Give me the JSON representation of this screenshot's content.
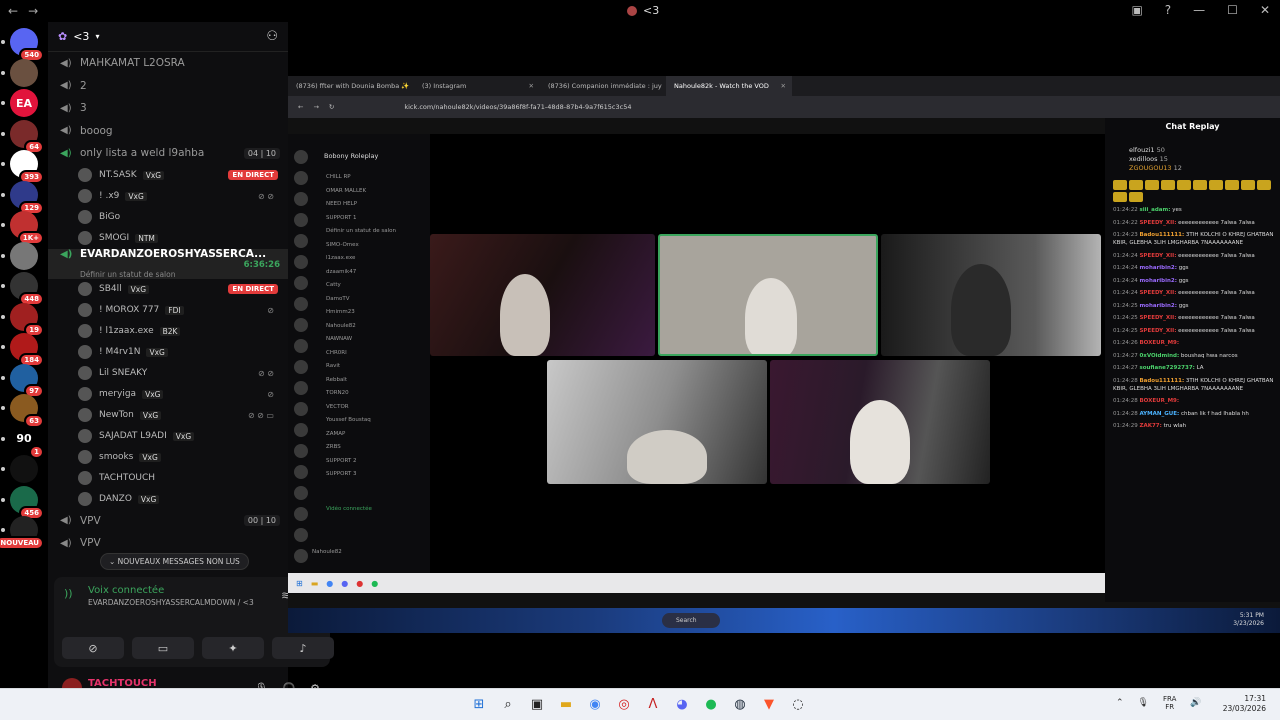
{
  "window": {
    "title": "<3"
  },
  "servers": [
    {
      "label": "",
      "badge": "540",
      "color": "#5865f2"
    },
    {
      "label": "",
      "badge": "",
      "color": "#6a5040"
    },
    {
      "label": "EA",
      "badge": "",
      "color": "#e1143c"
    },
    {
      "label": "",
      "badge": "64",
      "color": "#7a2a2a"
    },
    {
      "label": "",
      "badge": "393",
      "color": "#ffffff"
    },
    {
      "label": "",
      "badge": "129",
      "color": "#2f3a8a"
    },
    {
      "label": "",
      "badge": "1K+",
      "color": "#c03030"
    },
    {
      "label": "",
      "badge": "",
      "color": "#777"
    },
    {
      "label": "",
      "badge": "448",
      "color": "#333"
    },
    {
      "label": "",
      "badge": "19",
      "color": "#a02020"
    },
    {
      "label": "",
      "badge": "184",
      "color": "#b01a1a"
    },
    {
      "label": "",
      "badge": "97",
      "color": "#2060a0"
    },
    {
      "label": "",
      "badge": "63",
      "color": "#8a5a20"
    },
    {
      "label": "90",
      "badge": "1",
      "color": "#000"
    },
    {
      "label": "",
      "badge": "",
      "color": "#111"
    },
    {
      "label": "",
      "badge": "456",
      "color": "#1a6a4a"
    },
    {
      "label": "",
      "badge": "NOUVEAU",
      "color": "#222"
    }
  ],
  "server_header": {
    "name": "<3"
  },
  "channels": [
    {
      "type": "vc",
      "name": "MAHKAMAT L2OSRA"
    },
    {
      "type": "vc",
      "name": "2"
    },
    {
      "type": "vc",
      "name": "3"
    },
    {
      "type": "vc",
      "name": "booog"
    },
    {
      "type": "vc",
      "name": "only lista a weld l9ahba",
      "count": "04 | 10",
      "green": true
    },
    {
      "type": "member",
      "name": "NT.SASK",
      "tag": "VxG",
      "live": "EN DIRECT"
    },
    {
      "type": "member",
      "name": "! .x9",
      "tag": "VxG",
      "mute": "⊘ ⊘"
    },
    {
      "type": "member",
      "name": "BiGo"
    },
    {
      "type": "member",
      "name": "SMOGI",
      "tag": "NTM"
    },
    {
      "type": "active",
      "name": "EVARDANZOEROSHYASSERCA...",
      "timer": "6:36:26",
      "status": "Définir un statut de salon"
    },
    {
      "type": "member",
      "name": "SB4ll",
      "tag": "VxG",
      "live": "EN DIRECT"
    },
    {
      "type": "member",
      "name": "! MOROX 777",
      "tag": "FDI",
      "mute": "⊘"
    },
    {
      "type": "member",
      "name": "! l1zaax.exe",
      "tag": "B2K"
    },
    {
      "type": "member",
      "name": "! M4rv1N",
      "tag": "VxG"
    },
    {
      "type": "member",
      "name": "Lil SNEAKY",
      "mute": "⊘ ⊘"
    },
    {
      "type": "member",
      "name": "meryiga",
      "tag": "VxG",
      "mute": "⊘"
    },
    {
      "type": "member",
      "name": "NewTon",
      "tag": "VxG",
      "mute": "⊘ ⊘ ▭"
    },
    {
      "type": "member",
      "name": "SAJADAT L9ADI",
      "tag": "VxG"
    },
    {
      "type": "member",
      "name": "smooks",
      "tag": "VxG"
    },
    {
      "type": "member",
      "name": "TACHTOUCH"
    },
    {
      "type": "member",
      "name": "DANZO",
      "tag": "VxG"
    },
    {
      "type": "vc",
      "name": "VPV",
      "count": "00 | 10"
    },
    {
      "type": "vc",
      "name": "VPV"
    }
  ],
  "unread_pill": "NOUVEAUX MESSAGES NON LUS",
  "voice": {
    "title": "Voix connectée",
    "channel": "EVARDANZOEROSHYASSERCALMDOWN / <3"
  },
  "user": {
    "name": "TACHTOUCH",
    "id": "tachtouch"
  },
  "browser": {
    "tabs": [
      {
        "label": "(8736) ffter with Dounia Bomba ✨"
      },
      {
        "label": "(3) Instagram"
      },
      {
        "label": "(8736) Companion immédiate : juy"
      },
      {
        "label": "Nahoule82k - Watch the VOD",
        "selected": true
      }
    ],
    "url": "kick.com/nahoule82k/videos/39a86f8f-fa71-48d8-87b4-9a7f615c3c54"
  },
  "inner_discord": {
    "server": "Bobony Roleplay",
    "rows": [
      "CHILL RP",
      "OMAR MALLEK",
      "NEED HELP",
      "SUPPORT 1",
      "Définir un statut de salon",
      "SIMO-Omex",
      "l1zaax.exe",
      "dzaamik47",
      "Catty",
      "DamoTV",
      "Hmimm23",
      "Nahoule82",
      "NAWNAW",
      "CHR0RI",
      "Ravit",
      "Rebbalt",
      "TORN20",
      "VECTOR",
      "Youssef Boustaq",
      "ZAMAP",
      "ZRBS",
      "SUPPORT 2",
      "SUPPORT 3"
    ],
    "voice_status": "Vidéo connectée",
    "user": "Nahoule82"
  },
  "chat": {
    "title": "Chat Replay",
    "top": [
      {
        "name": "elfouzi1",
        "count": "50"
      },
      {
        "name": "xedilloos",
        "count": "15"
      },
      {
        "name": "ZGOUGOU13",
        "count": "12"
      }
    ],
    "messages": [
      {
        "time": "01:24:22",
        "user": "siii_adam:",
        "text": "yes",
        "color": "#4bd16b"
      },
      {
        "time": "01:24:22",
        "user": "SPEEDY_XII:",
        "text": "eeeeeeeeeeee 7alwa 7alwa",
        "color": "#e23b3b"
      },
      {
        "time": "01:24:23",
        "user": "Badou111111:",
        "text": "3TIH KOLCHI O KHREJ GHATBAN KBIR, GLEBHA 3LIH LMGHARBA 7NAAAAAAANE",
        "color": "#f0a030"
      },
      {
        "time": "01:24:24",
        "user": "SPEEDY_XII:",
        "text": "eeeeeeeeeeee 7alwa 7alwa",
        "color": "#e23b3b"
      },
      {
        "time": "01:24:24",
        "user": "moharibin2:",
        "text": "ggs",
        "color": "#9b6bff"
      },
      {
        "time": "01:24:24",
        "user": "moharibin2:",
        "text": "ggs",
        "color": "#9b6bff"
      },
      {
        "time": "01:24:24",
        "user": "SPEEDY_XII:",
        "text": "eeeeeeeeeeee 7alwa 7alwa",
        "color": "#e23b3b"
      },
      {
        "time": "01:24:25",
        "user": "moharibin2:",
        "text": "ggs",
        "color": "#9b6bff"
      },
      {
        "time": "01:24:25",
        "user": "SPEEDY_XII:",
        "text": "eeeeeeeeeeee 7alwa 7alwa",
        "color": "#e23b3b"
      },
      {
        "time": "01:24:25",
        "user": "SPEEDY_XII:",
        "text": "eeeeeeeeeeee 7alwa 7alwa",
        "color": "#e23b3b"
      },
      {
        "time": "01:24:26",
        "user": "BOXEUR_M9:",
        "text": "",
        "color": "#e23b3b"
      },
      {
        "time": "01:24:27",
        "user": "0xVOidmind:",
        "text": "boushaq hwa narcos",
        "color": "#4bd16b"
      },
      {
        "time": "01:24:27",
        "user": "soufiane7292737:",
        "text": "LA",
        "color": "#4bd16b"
      },
      {
        "time": "01:24:28",
        "user": "Badou111111:",
        "text": "3TIH KOLCHI O KHREJ GHATBAN KBIR, GLEBHA 3LIH LMGHARBA 7NAAAAAAANE",
        "color": "#f0a030"
      },
      {
        "time": "01:24:28",
        "user": "BOXEUR_M9:",
        "text": "",
        "color": "#e23b3b"
      },
      {
        "time": "01:24:28",
        "user": "AYMAN_GUE:",
        "text": "chban lik f had lhabla hh",
        "color": "#4bb3ff"
      },
      {
        "time": "01:24:29",
        "user": "ZAK77:",
        "text": "tru wlah",
        "color": "#e23b3b"
      }
    ]
  },
  "inner_taskbar": {
    "search": "Search",
    "time": "5:31 PM",
    "date": "3/23/2026"
  },
  "taskbar": {
    "lang_1": "FRA",
    "lang_2": "FR",
    "time": "17:31",
    "date": "23/03/2026"
  }
}
